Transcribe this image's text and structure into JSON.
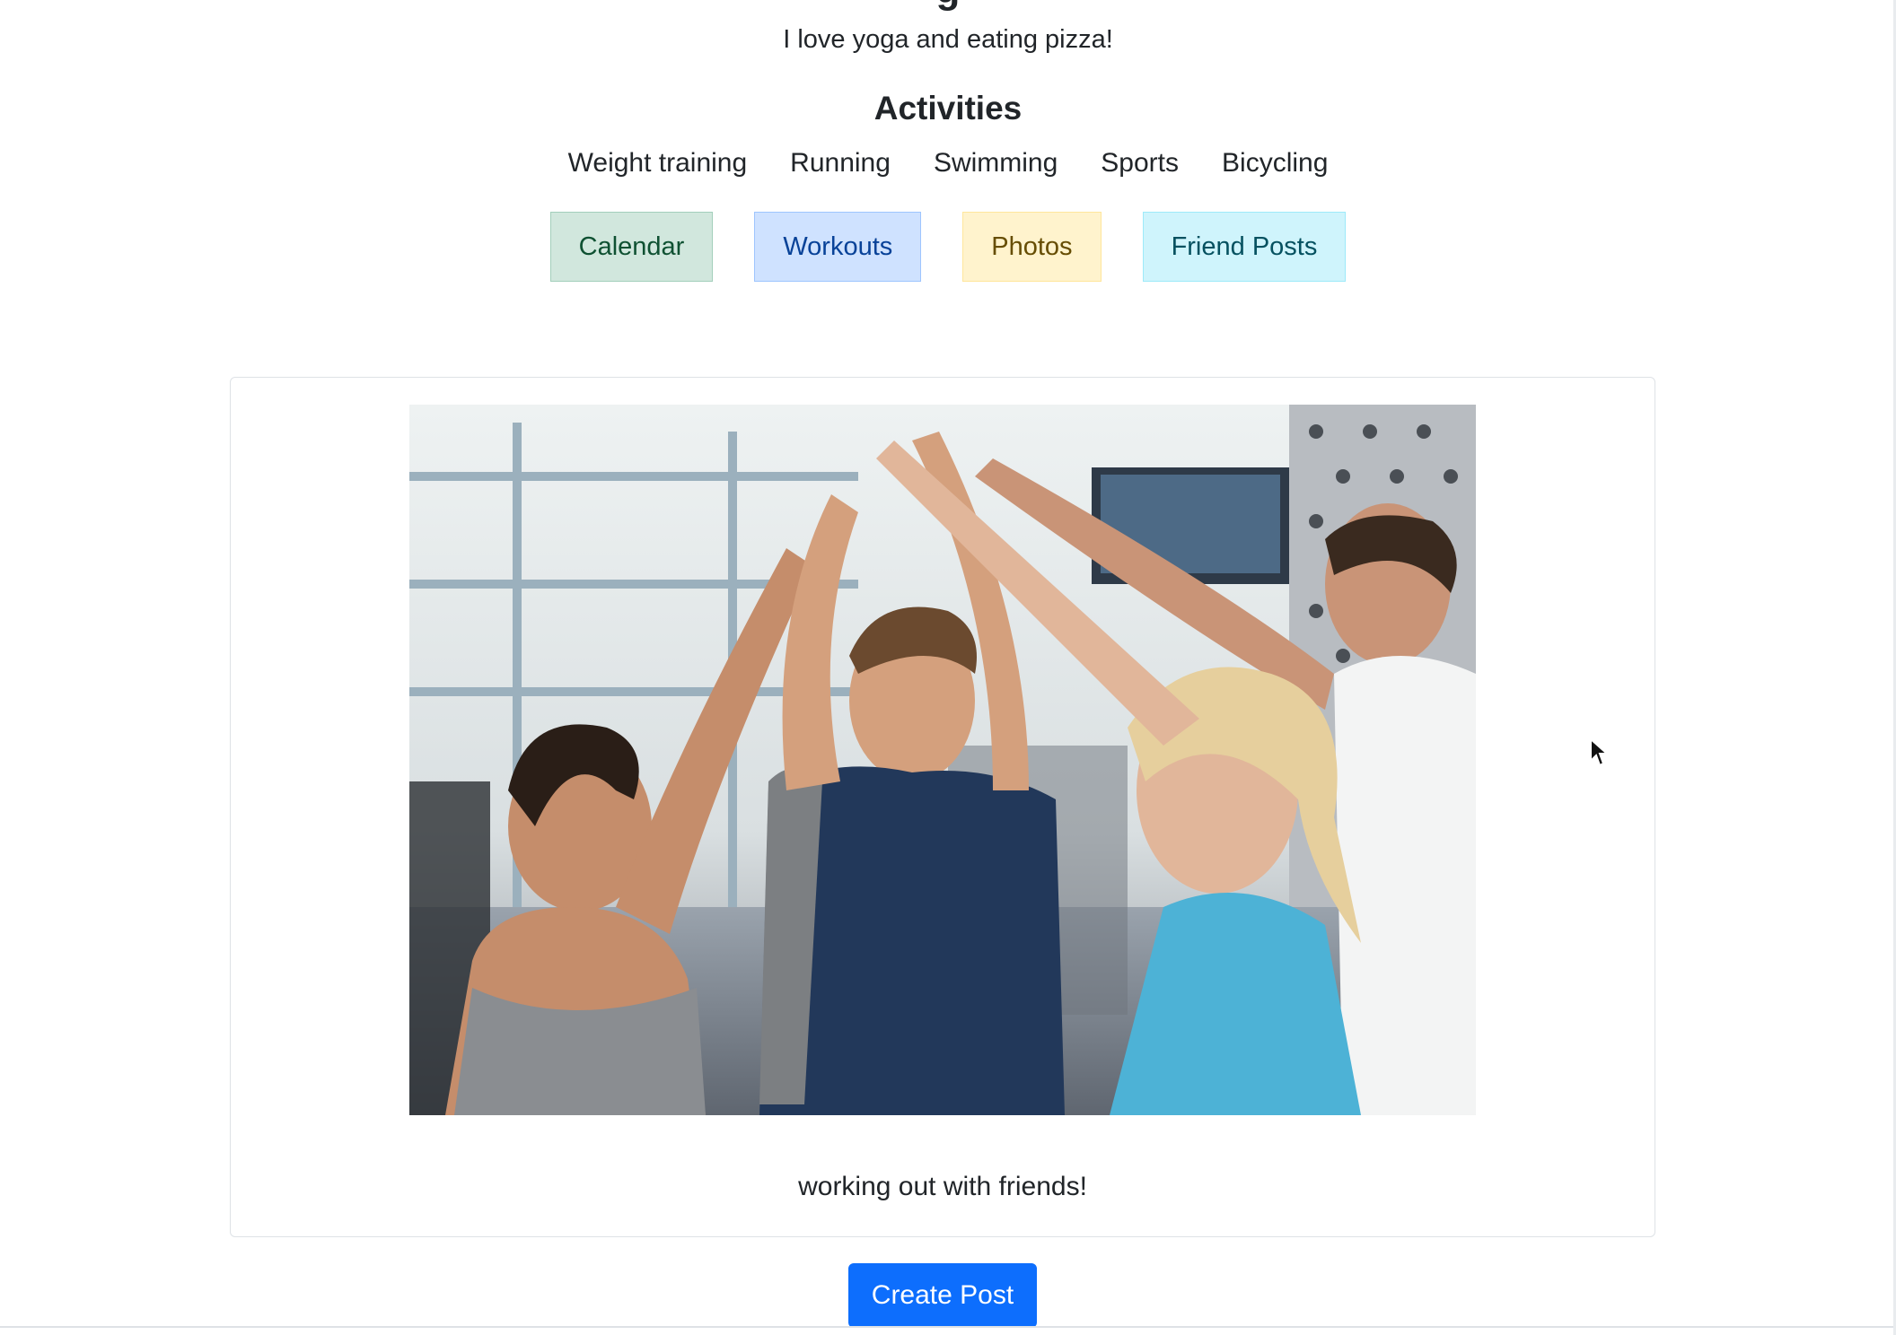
{
  "profile": {
    "username_partial": "g",
    "bio": "I love yoga and eating pizza!"
  },
  "activities": {
    "title": "Activities",
    "items": [
      "Weight training",
      "Running",
      "Swimming",
      "Sports",
      "Bicycling"
    ]
  },
  "nav": {
    "calendar": "Calendar",
    "workouts": "Workouts",
    "photos": "Photos",
    "friend_posts": "Friend Posts"
  },
  "post": {
    "caption": "working out with friends!",
    "image_icon": "group-high-five-photo"
  },
  "actions": {
    "create_post": "Create Post"
  },
  "colors": {
    "primary": "#0d6efd",
    "calendar_bg": "#d1e7dd",
    "workouts_bg": "#cfe2ff",
    "photos_bg": "#fff3cd",
    "friends_bg": "#cff4fc"
  }
}
